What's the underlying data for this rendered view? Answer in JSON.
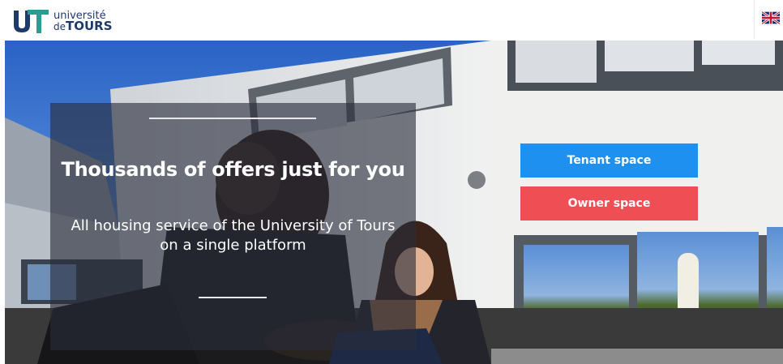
{
  "header": {
    "logo": {
      "line1": "université",
      "line2_prefix": "de",
      "line2_main": "TOURS"
    },
    "language_flag": "uk-flag-icon"
  },
  "hero": {
    "headline": "Thousands of offers just for you",
    "subtext": "All housing service of the University of Tours on a single platform"
  },
  "actions": {
    "tenant_label": "Tenant space",
    "owner_label": "Owner space"
  },
  "colors": {
    "tenant": "#1e90f0",
    "owner": "#f04e55",
    "brand_navy": "#1d3a6b",
    "brand_green": "#2b9c8f"
  }
}
